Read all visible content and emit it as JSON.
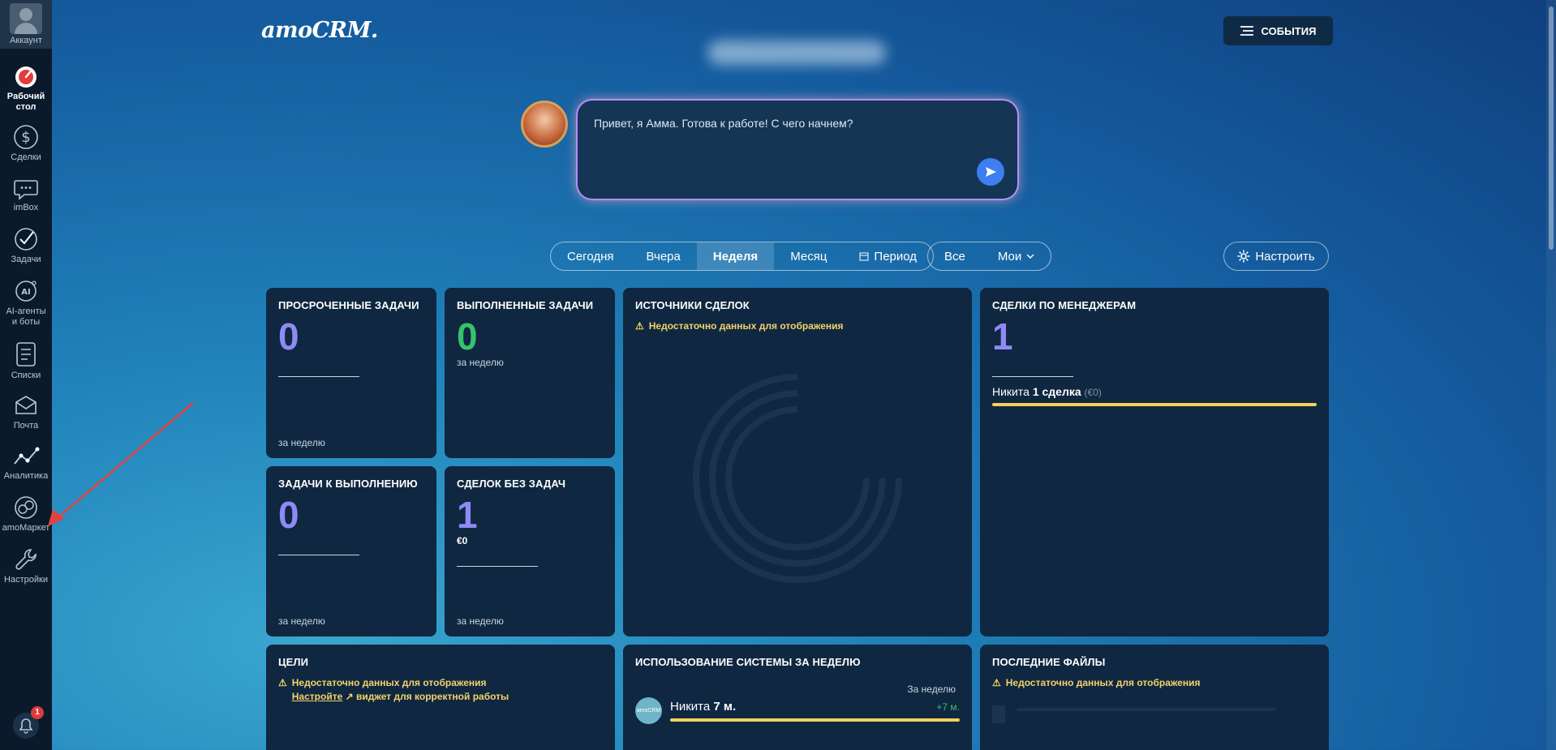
{
  "sidebar": {
    "account": "Аккаунт",
    "items": [
      {
        "label": "Рабочий стол",
        "icon": "dashboard-icon"
      },
      {
        "label": "Сделки",
        "icon": "dollar-icon"
      },
      {
        "label": "imBox",
        "icon": "chat-icon"
      },
      {
        "label": "Задачи",
        "icon": "check-icon"
      },
      {
        "label": "AI-агенты и боты",
        "icon": "ai-icon"
      },
      {
        "label": "Списки",
        "icon": "list-icon"
      },
      {
        "label": "Почта",
        "icon": "mail-icon"
      },
      {
        "label": "Аналитика",
        "icon": "analytics-icon"
      },
      {
        "label": "amoМаркет",
        "icon": "market-icon"
      },
      {
        "label": "Настройки",
        "icon": "wrench-icon"
      }
    ],
    "notifications_count": "1"
  },
  "header": {
    "logo": "amoCRM.",
    "events_label": "СОБЫТИЯ"
  },
  "ai": {
    "message": "Привет, я Амма. Готова к работе! С чего начнем?"
  },
  "filters": {
    "periods": [
      "Сегодня",
      "Вчера",
      "Неделя",
      "Месяц",
      "Период"
    ],
    "selected_period": "Неделя",
    "scope": [
      "Все",
      "Мои"
    ],
    "setup_label": "Настроить"
  },
  "cards": {
    "overdue": {
      "title": "ПРОСРОЧЕННЫЕ ЗАДАЧИ",
      "value": "0",
      "foot": "за неделю"
    },
    "done": {
      "title": "ВЫПОЛНЕННЫЕ ЗАДАЧИ",
      "value": "0",
      "sub": "за неделю"
    },
    "sources": {
      "title": "ИСТОЧНИКИ СДЕЛОК",
      "warning": "Недостаточно данных для отображения"
    },
    "by_managers": {
      "title": "СДЕЛКИ ПО МЕНЕДЖЕРАМ",
      "value": "1",
      "manager": "Никита",
      "deals": "1 сделка",
      "amount": "(€0)",
      "progress": 1.0
    },
    "todo": {
      "title": "ЗАДАЧИ К ВЫПОЛНЕНИЮ",
      "value": "0",
      "foot": "за неделю"
    },
    "no_tasks": {
      "title": "СДЕЛОК БЕЗ ЗАДАЧ",
      "value": "1",
      "amount": "€0",
      "foot": "за неделю"
    },
    "goals": {
      "title": "ЦЕЛИ",
      "warning": "Недостаточно данных для отображения",
      "link": "Настройте",
      "hint": "виджет для корректной работы"
    },
    "usage": {
      "title": "ИСПОЛЬЗОВАНИЕ СИСТЕМЫ ЗА НЕДЕЛЮ",
      "period": "За неделю",
      "user": "Никита",
      "time": "7 м.",
      "delta": "+7 м.",
      "avatar_text": "amoCRM",
      "progress": 1.0
    },
    "files": {
      "title": "ПОСЛЕДНИЕ ФАЙЛЫ",
      "warning": "Недостаточно данных для отображения"
    }
  },
  "colors": {
    "accent_purple": "#8f8af5",
    "accent_green": "#35c26b",
    "warning_yellow": "#f3d26b",
    "card_bg": "#0f2740",
    "sidebar_bg": "#0b1a2b"
  }
}
